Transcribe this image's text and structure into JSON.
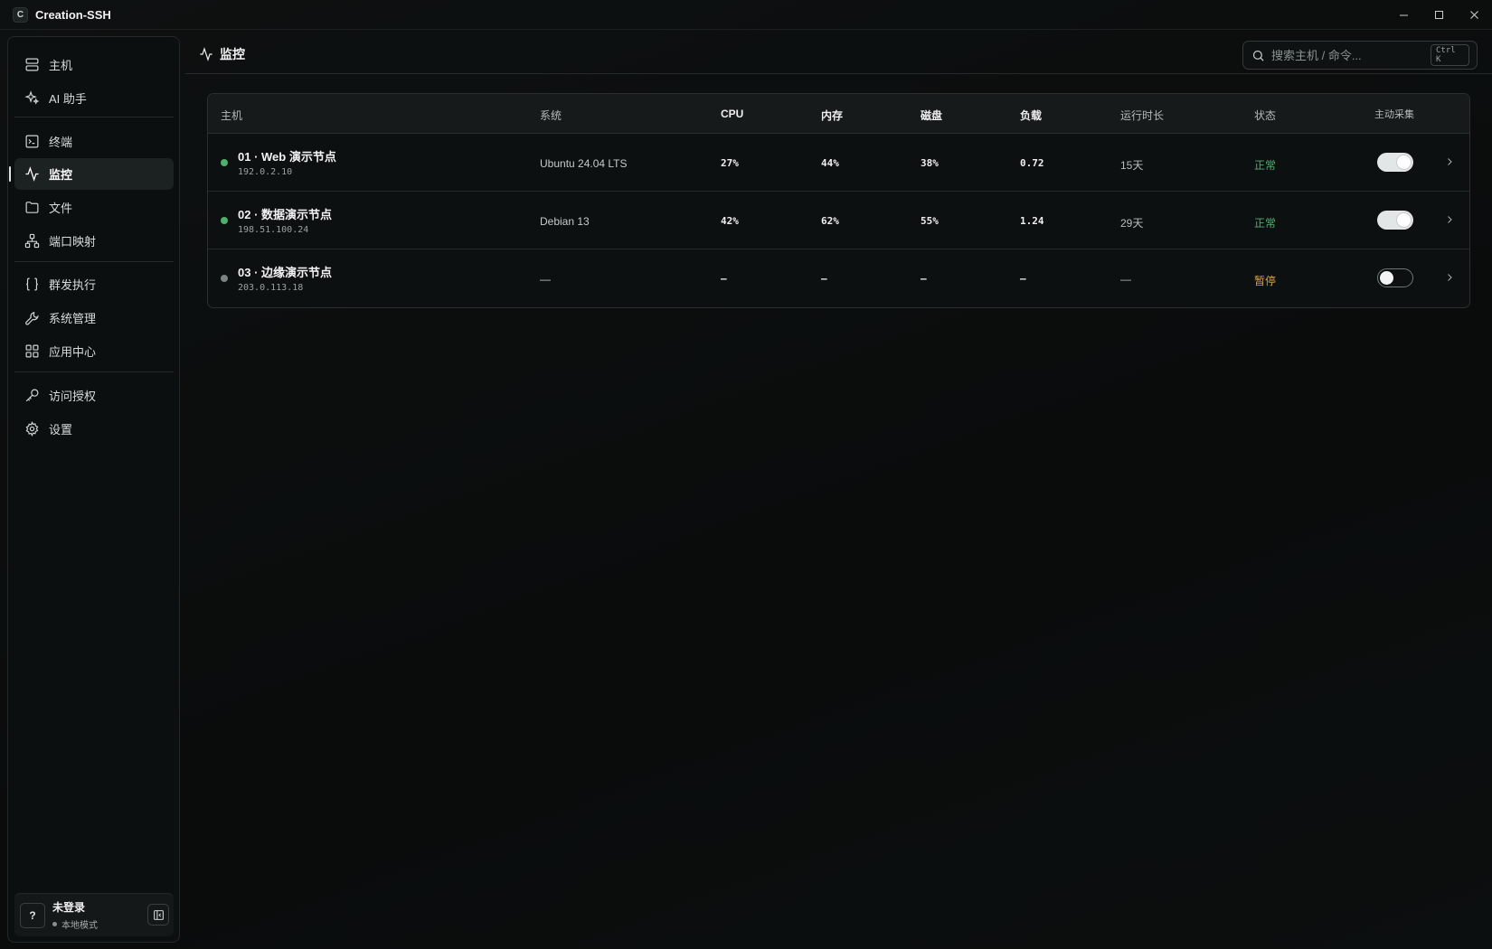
{
  "app": {
    "logo_letter": "C",
    "title": "Creation-SSH"
  },
  "window_controls": {
    "minimize": "—",
    "maximize": "☐",
    "close": "✕"
  },
  "sidebar": {
    "items": [
      {
        "label": "主机",
        "icon": "server-icon"
      },
      {
        "label": "AI 助手",
        "icon": "sparkles-icon"
      },
      {
        "label": "终端",
        "icon": "terminal-icon"
      },
      {
        "label": "监控",
        "icon": "activity-icon",
        "active": true
      },
      {
        "label": "文件",
        "icon": "folder-icon"
      },
      {
        "label": "端口映射",
        "icon": "network-icon"
      },
      {
        "label": "群发执行",
        "icon": "braces-icon"
      },
      {
        "label": "系统管理",
        "icon": "wrench-icon"
      },
      {
        "label": "应用中心",
        "icon": "grid-icon"
      },
      {
        "label": "访问授权",
        "icon": "key-icon"
      },
      {
        "label": "设置",
        "icon": "gear-icon"
      }
    ],
    "user": {
      "avatar": "?",
      "name": "未登录",
      "mode": "本地模式"
    }
  },
  "header": {
    "title": "监控",
    "search_placeholder": "搜索主机 / 命令...",
    "search_shortcut": "Ctrl K"
  },
  "table": {
    "columns": {
      "host": "主机",
      "os": "系统",
      "cpu": "CPU",
      "mem": "内存",
      "disk": "磁盘",
      "load": "负载",
      "uptime": "运行时长",
      "state": "状态",
      "collect": "主动采集"
    },
    "rows": [
      {
        "name": "01 · Web 演示节点",
        "ip": "192.0.2.10",
        "os": "Ubuntu 24.04 LTS",
        "cpu": "27%",
        "mem": "44%",
        "disk": "38%",
        "load": "0.72",
        "uptime": "15天",
        "state": "正常",
        "online": true,
        "collect": true
      },
      {
        "name": "02 · 数据演示节点",
        "ip": "198.51.100.24",
        "os": "Debian 13",
        "cpu": "42%",
        "mem": "62%",
        "disk": "55%",
        "load": "1.24",
        "uptime": "29天",
        "state": "正常",
        "online": true,
        "collect": true
      },
      {
        "name": "03 · 边缘演示节点",
        "ip": "203.0.113.18",
        "os": "—",
        "cpu": "–",
        "mem": "–",
        "disk": "–",
        "load": "–",
        "uptime": "—",
        "state": "暂停",
        "online": false,
        "collect": false
      }
    ]
  },
  "colors": {
    "online": "#4caf6e",
    "offline": "#7a8282",
    "state_ok": "#4caf6e",
    "state_paused": "#d9a23f"
  }
}
